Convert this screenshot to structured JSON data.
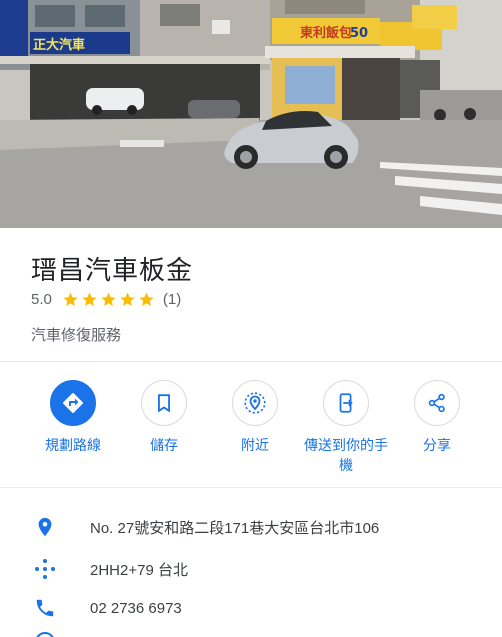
{
  "place": {
    "name": "瑨昌汽車板金",
    "rating": "5.0",
    "star_count": 5,
    "review_count": "(1)",
    "category": "汽車修復服務"
  },
  "photo": {
    "shop_sign_left": "正大汽車",
    "shop_sign_right": "東利飯包",
    "shop_sign_number": "50"
  },
  "actions": [
    {
      "label": "規劃路線",
      "icon": "directions-icon"
    },
    {
      "label": "儲存",
      "icon": "bookmark-icon"
    },
    {
      "label": "附近",
      "icon": "nearby-icon"
    },
    {
      "label": "傳送到你的手機",
      "icon": "send-to-phone-icon"
    },
    {
      "label": "分享",
      "icon": "share-icon"
    }
  ],
  "info": {
    "address": "No. 27號安和路二段171巷大安區台北市106",
    "plus_code": "2HH2+79 台北",
    "phone": "02 2736 6973"
  },
  "colors": {
    "accent": "#1a73e8",
    "star": "#fbbc04",
    "secondary_text": "#5f6368"
  }
}
